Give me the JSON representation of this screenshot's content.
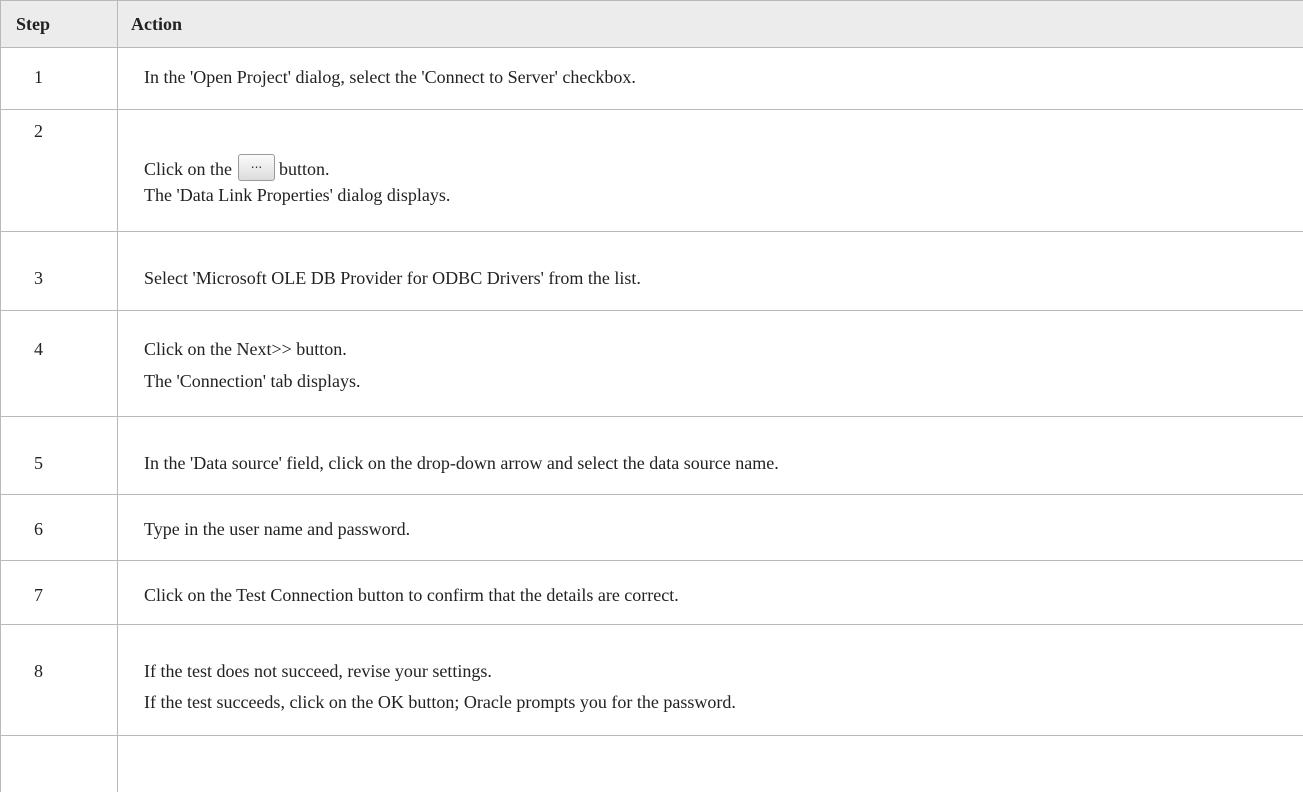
{
  "table": {
    "headers": {
      "step": "Step",
      "action": "Action"
    },
    "rows": [
      {
        "step": "1",
        "lines": [
          "In the 'Open Project' dialog, select the 'Connect to Server' checkbox."
        ]
      },
      {
        "step": "2",
        "lines": [
          "Click on the",
          "button.",
          "The 'Data Link Properties' dialog displays."
        ],
        "inline_button_label": "..."
      },
      {
        "step": "3",
        "lines": [
          "Select 'Microsoft OLE DB Provider for ODBC Drivers' from the list."
        ]
      },
      {
        "step": "4",
        "lines": [
          "Click on the Next>> button.",
          "The 'Connection' tab displays."
        ]
      },
      {
        "step": "5",
        "lines": [
          "In the 'Data source' field, click on the drop-down arrow and select the data source name."
        ]
      },
      {
        "step": "6",
        "lines": [
          "Type in the user name and password."
        ]
      },
      {
        "step": "7",
        "lines": [
          "Click on the Test Connection button to confirm that the details are correct."
        ]
      },
      {
        "step": "8",
        "lines": [
          "If the test does not succeed, revise your settings.",
          "If the test succeeds, click on the OK button; Oracle prompts you for the password."
        ]
      }
    ]
  }
}
